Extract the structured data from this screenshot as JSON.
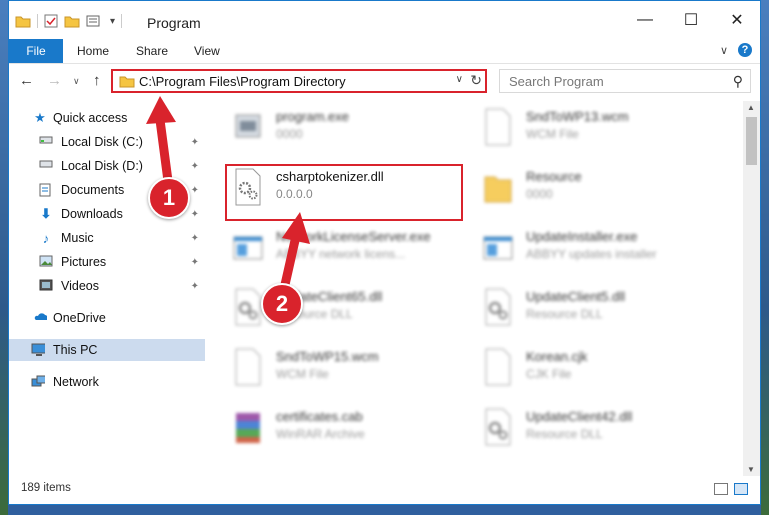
{
  "window": {
    "title": "Program",
    "controls": {
      "minimize": "—",
      "maximize": "☐",
      "close": "✕"
    }
  },
  "ribbon": {
    "tabs": [
      "File",
      "Home",
      "Share",
      "View"
    ],
    "expand_glyph": "∨",
    "help_glyph": "?"
  },
  "navigation": {
    "back_glyph": "←",
    "forward_glyph": "→",
    "recent_glyph": "∨",
    "up_glyph": "↑",
    "address": "C:\\Program Files\\Program Directory",
    "address_dropdown_glyph": "∨",
    "refresh_glyph": "↻",
    "search_placeholder": "Search Program",
    "search_glyph": "⚲"
  },
  "sidebar": {
    "items": [
      {
        "label": "Quick access",
        "icon": "star-icon",
        "pinned": false
      },
      {
        "label": "Local Disk (C:)",
        "icon": "drive-icon",
        "pinned": true
      },
      {
        "label": "Local Disk (D:)",
        "icon": "drive-icon",
        "pinned": true
      },
      {
        "label": "Documents",
        "icon": "documents-icon",
        "pinned": true
      },
      {
        "label": "Downloads",
        "icon": "downloads-icon",
        "pinned": true
      },
      {
        "label": "Music",
        "icon": "music-icon",
        "pinned": true
      },
      {
        "label": "Pictures",
        "icon": "pictures-icon",
        "pinned": true
      },
      {
        "label": "Videos",
        "icon": "videos-icon",
        "pinned": true
      },
      {
        "label": "OneDrive",
        "icon": "onedrive-icon",
        "pinned": false
      },
      {
        "label": "This PC",
        "icon": "this-pc-icon",
        "pinned": false,
        "selected": true
      },
      {
        "label": "Network",
        "icon": "network-icon",
        "pinned": false
      }
    ],
    "pin_glyph": "📌"
  },
  "files": [
    {
      "name": "program.exe",
      "sub": "0000",
      "icon": "exe-icon",
      "blurred": true
    },
    {
      "name": "SndToWP13.wcm",
      "sub": "WCM File",
      "icon": "blank-file-icon",
      "blurred": true
    },
    {
      "name": "csharptokenizer.dll",
      "sub": "0.0.0.0",
      "icon": "dll-gear-icon",
      "blurred": false
    },
    {
      "name": "Resource",
      "sub": "0000",
      "icon": "folder-icon",
      "blurred": true
    },
    {
      "name": "NetworkLicenseServer.exe",
      "sub": "ABBYY network licens...",
      "icon": "app-window-icon",
      "blurred": true
    },
    {
      "name": "UpdateInstaller.exe",
      "sub": "ABBYY updates installer",
      "icon": "app-window-icon",
      "blurred": true
    },
    {
      "name": "UpdateClient65.dll",
      "sub": "Resource DLL",
      "icon": "dll-gear-icon",
      "blurred": true
    },
    {
      "name": "UpdateClient5.dll",
      "sub": "Resource DLL",
      "icon": "dll-gear-icon",
      "blurred": true
    },
    {
      "name": "SndToWP15.wcm",
      "sub": "WCM File",
      "icon": "blank-file-icon",
      "blurred": true
    },
    {
      "name": "Korean.cjk",
      "sub": "CJK File",
      "icon": "blank-file-icon",
      "blurred": true
    },
    {
      "name": "certificates.cab",
      "sub": "WinRAR Archive",
      "icon": "winrar-icon",
      "blurred": true
    },
    {
      "name": "UpdateClient42.dll",
      "sub": "Resource DLL",
      "icon": "dll-gear-icon",
      "blurred": true
    }
  ],
  "status": {
    "item_count": "189 items"
  },
  "annotations": {
    "step1": "1",
    "step2": "2",
    "highlight_color": "#d9232c"
  },
  "colors": {
    "accent": "#1979ca",
    "selected": "#ccdbee"
  }
}
